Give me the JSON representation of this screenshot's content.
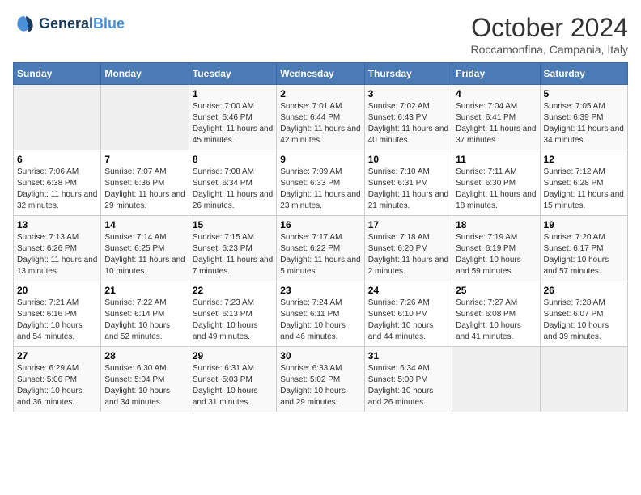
{
  "header": {
    "logo_line1": "General",
    "logo_line2": "Blue",
    "month": "October 2024",
    "location": "Roccamonfina, Campania, Italy"
  },
  "weekdays": [
    "Sunday",
    "Monday",
    "Tuesday",
    "Wednesday",
    "Thursday",
    "Friday",
    "Saturday"
  ],
  "weeks": [
    [
      {
        "day": "",
        "info": ""
      },
      {
        "day": "",
        "info": ""
      },
      {
        "day": "1",
        "info": "Sunrise: 7:00 AM\nSunset: 6:46 PM\nDaylight: 11 hours and 45 minutes."
      },
      {
        "day": "2",
        "info": "Sunrise: 7:01 AM\nSunset: 6:44 PM\nDaylight: 11 hours and 42 minutes."
      },
      {
        "day": "3",
        "info": "Sunrise: 7:02 AM\nSunset: 6:43 PM\nDaylight: 11 hours and 40 minutes."
      },
      {
        "day": "4",
        "info": "Sunrise: 7:04 AM\nSunset: 6:41 PM\nDaylight: 11 hours and 37 minutes."
      },
      {
        "day": "5",
        "info": "Sunrise: 7:05 AM\nSunset: 6:39 PM\nDaylight: 11 hours and 34 minutes."
      }
    ],
    [
      {
        "day": "6",
        "info": "Sunrise: 7:06 AM\nSunset: 6:38 PM\nDaylight: 11 hours and 32 minutes."
      },
      {
        "day": "7",
        "info": "Sunrise: 7:07 AM\nSunset: 6:36 PM\nDaylight: 11 hours and 29 minutes."
      },
      {
        "day": "8",
        "info": "Sunrise: 7:08 AM\nSunset: 6:34 PM\nDaylight: 11 hours and 26 minutes."
      },
      {
        "day": "9",
        "info": "Sunrise: 7:09 AM\nSunset: 6:33 PM\nDaylight: 11 hours and 23 minutes."
      },
      {
        "day": "10",
        "info": "Sunrise: 7:10 AM\nSunset: 6:31 PM\nDaylight: 11 hours and 21 minutes."
      },
      {
        "day": "11",
        "info": "Sunrise: 7:11 AM\nSunset: 6:30 PM\nDaylight: 11 hours and 18 minutes."
      },
      {
        "day": "12",
        "info": "Sunrise: 7:12 AM\nSunset: 6:28 PM\nDaylight: 11 hours and 15 minutes."
      }
    ],
    [
      {
        "day": "13",
        "info": "Sunrise: 7:13 AM\nSunset: 6:26 PM\nDaylight: 11 hours and 13 minutes."
      },
      {
        "day": "14",
        "info": "Sunrise: 7:14 AM\nSunset: 6:25 PM\nDaylight: 11 hours and 10 minutes."
      },
      {
        "day": "15",
        "info": "Sunrise: 7:15 AM\nSunset: 6:23 PM\nDaylight: 11 hours and 7 minutes."
      },
      {
        "day": "16",
        "info": "Sunrise: 7:17 AM\nSunset: 6:22 PM\nDaylight: 11 hours and 5 minutes."
      },
      {
        "day": "17",
        "info": "Sunrise: 7:18 AM\nSunset: 6:20 PM\nDaylight: 11 hours and 2 minutes."
      },
      {
        "day": "18",
        "info": "Sunrise: 7:19 AM\nSunset: 6:19 PM\nDaylight: 10 hours and 59 minutes."
      },
      {
        "day": "19",
        "info": "Sunrise: 7:20 AM\nSunset: 6:17 PM\nDaylight: 10 hours and 57 minutes."
      }
    ],
    [
      {
        "day": "20",
        "info": "Sunrise: 7:21 AM\nSunset: 6:16 PM\nDaylight: 10 hours and 54 minutes."
      },
      {
        "day": "21",
        "info": "Sunrise: 7:22 AM\nSunset: 6:14 PM\nDaylight: 10 hours and 52 minutes."
      },
      {
        "day": "22",
        "info": "Sunrise: 7:23 AM\nSunset: 6:13 PM\nDaylight: 10 hours and 49 minutes."
      },
      {
        "day": "23",
        "info": "Sunrise: 7:24 AM\nSunset: 6:11 PM\nDaylight: 10 hours and 46 minutes."
      },
      {
        "day": "24",
        "info": "Sunrise: 7:26 AM\nSunset: 6:10 PM\nDaylight: 10 hours and 44 minutes."
      },
      {
        "day": "25",
        "info": "Sunrise: 7:27 AM\nSunset: 6:08 PM\nDaylight: 10 hours and 41 minutes."
      },
      {
        "day": "26",
        "info": "Sunrise: 7:28 AM\nSunset: 6:07 PM\nDaylight: 10 hours and 39 minutes."
      }
    ],
    [
      {
        "day": "27",
        "info": "Sunrise: 6:29 AM\nSunset: 5:06 PM\nDaylight: 10 hours and 36 minutes."
      },
      {
        "day": "28",
        "info": "Sunrise: 6:30 AM\nSunset: 5:04 PM\nDaylight: 10 hours and 34 minutes."
      },
      {
        "day": "29",
        "info": "Sunrise: 6:31 AM\nSunset: 5:03 PM\nDaylight: 10 hours and 31 minutes."
      },
      {
        "day": "30",
        "info": "Sunrise: 6:33 AM\nSunset: 5:02 PM\nDaylight: 10 hours and 29 minutes."
      },
      {
        "day": "31",
        "info": "Sunrise: 6:34 AM\nSunset: 5:00 PM\nDaylight: 10 hours and 26 minutes."
      },
      {
        "day": "",
        "info": ""
      },
      {
        "day": "",
        "info": ""
      }
    ]
  ]
}
